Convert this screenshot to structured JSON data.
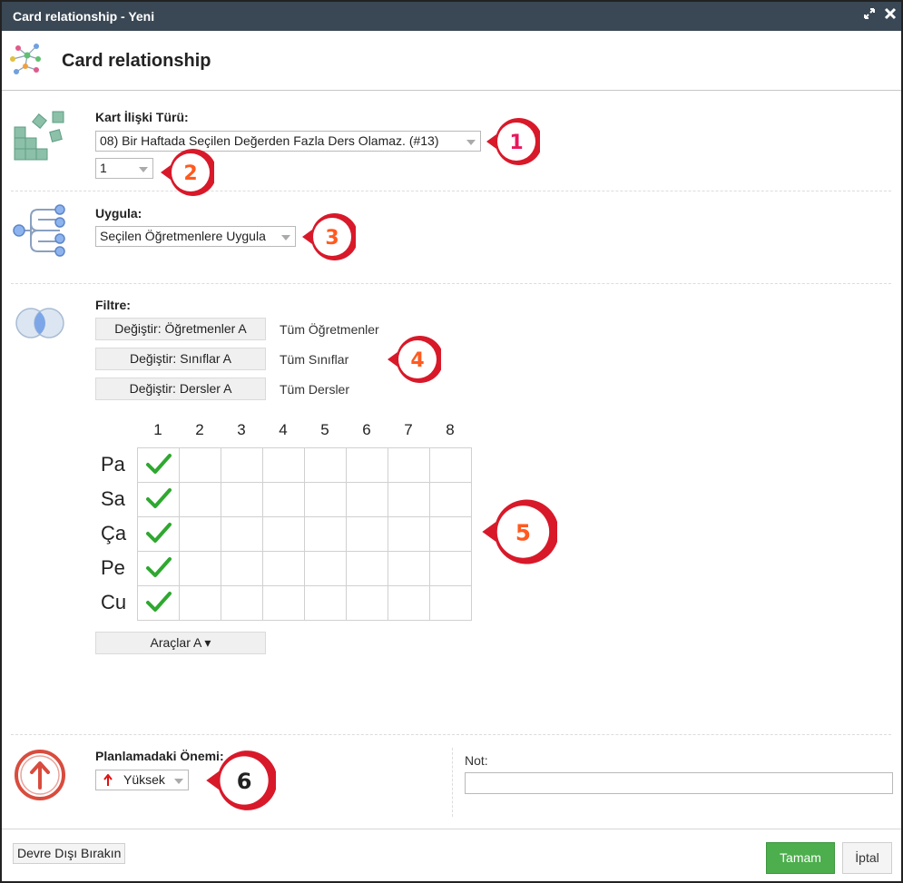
{
  "window": {
    "title": "Card relationship - Yeni"
  },
  "header": {
    "title": "Card relationship"
  },
  "relation_type": {
    "label": "Kart İlişki Türü:",
    "selected": "08) Bir Haftada Seçilen Değerden Fazla Ders Olamaz. (#13)",
    "value_selected": "1"
  },
  "apply": {
    "label": "Uygula:",
    "selected": "Seçilen Öğretmenlere Uygula"
  },
  "filter": {
    "label": "Filtre:",
    "rows": [
      {
        "button": "Değiştir: Öğretmenler A",
        "value": "Tüm Öğretmenler"
      },
      {
        "button": "Değiştir: Sınıflar A",
        "value": "Tüm Sınıflar"
      },
      {
        "button": "Değiştir: Dersler A",
        "value": "Tüm Dersler"
      }
    ]
  },
  "grid": {
    "columns": [
      "1",
      "2",
      "3",
      "4",
      "5",
      "6",
      "7",
      "8"
    ],
    "rows": [
      "Pa",
      "Sa",
      "Ça",
      "Pe",
      "Cu"
    ],
    "checked_column": "1"
  },
  "tools": {
    "label": "Araçlar A ▾"
  },
  "importance": {
    "label": "Planlamadaki Önemi:",
    "selected": "Yüksek"
  },
  "note": {
    "label": "Not:",
    "value": ""
  },
  "footer": {
    "disable_label": "Devre Dışı Bırakın",
    "ok_label": "Tamam",
    "cancel_label": "İptal"
  },
  "callouts": [
    "1",
    "2",
    "3",
    "4",
    "5",
    "6"
  ],
  "colors": {
    "titlebar": "#3a4754",
    "callout_red": "#d8192a",
    "callout_number_pink": "#e8175d",
    "callout_number_orange": "#ff5a1f",
    "ok_green": "#4cae4c",
    "check_green": "#2fa82f"
  }
}
